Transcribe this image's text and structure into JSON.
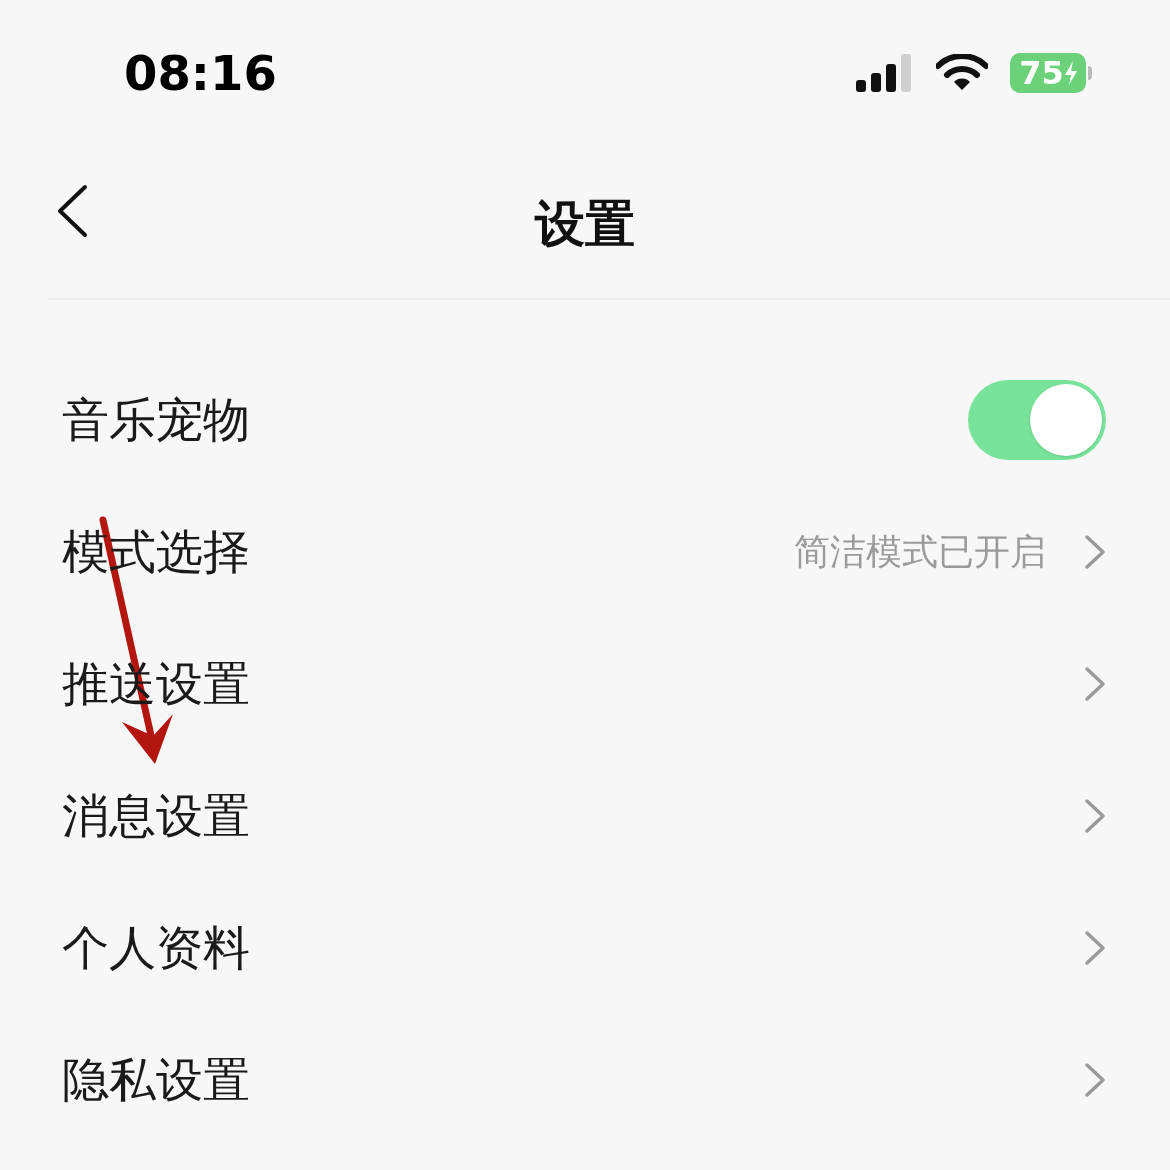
{
  "status_bar": {
    "time": "08:16",
    "battery": "75"
  },
  "nav": {
    "title": "设置"
  },
  "items": [
    {
      "kind": "toggle",
      "label": "音乐宠物",
      "on": true
    },
    {
      "kind": "link",
      "label": "模式选择",
      "value": "简洁模式已开启"
    },
    {
      "kind": "link",
      "label": "推送设置"
    },
    {
      "kind": "link",
      "label": "消息设置"
    },
    {
      "kind": "link",
      "label": "个人资料"
    },
    {
      "kind": "link",
      "label": "隐私设置"
    }
  ]
}
